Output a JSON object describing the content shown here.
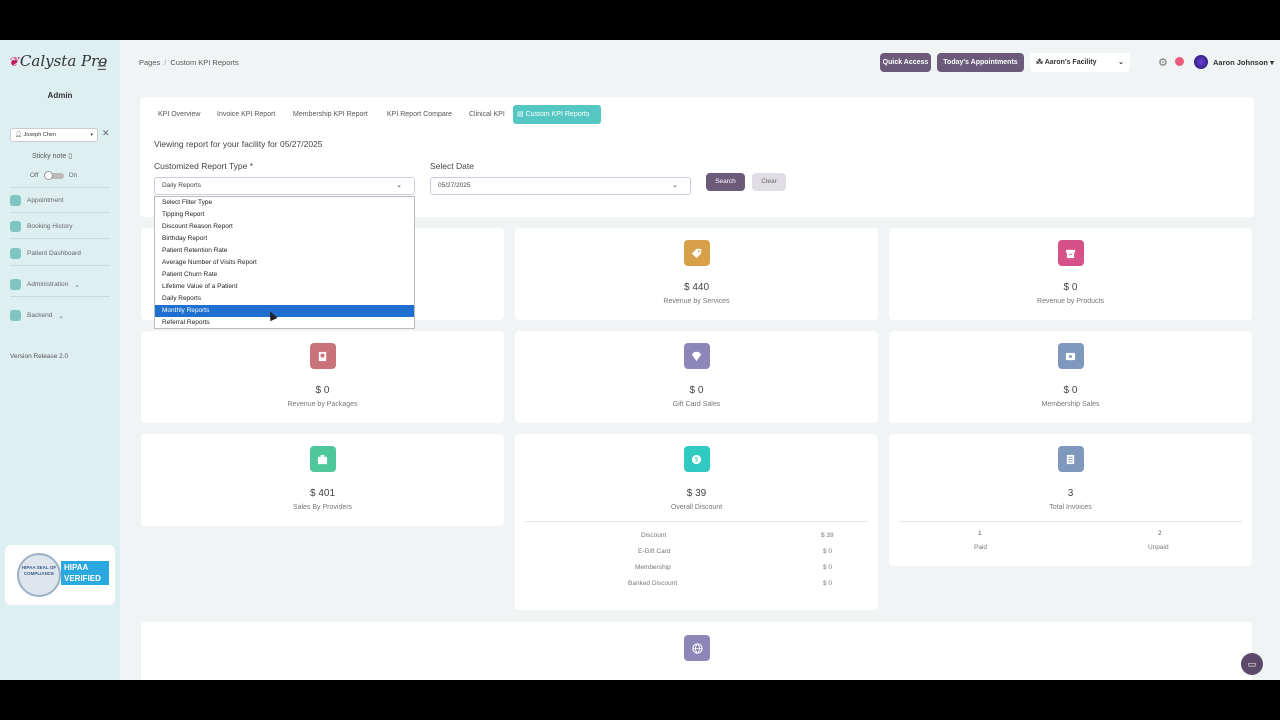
{
  "app": {
    "logo": "Calysta Pro",
    "role_label": "Admin",
    "version": "Version Release 2.0"
  },
  "sidebar": {
    "patient_selected": "Joseph Chen",
    "sticky_note": "Sticky note",
    "toggle_off": "Off",
    "toggle_on": "On",
    "items": [
      {
        "label": "Appointment"
      },
      {
        "label": "Booking History"
      },
      {
        "label": "Patient Dashboard"
      },
      {
        "label": "Administration"
      },
      {
        "label": "Backend"
      }
    ]
  },
  "header": {
    "breadcrumb": [
      "Pages",
      "Custom KPI Reports"
    ],
    "quick_access": "Quick Access",
    "todays_appointments": "Today's Appointments",
    "facility": "Aaron's Facility",
    "user_name": "Aaron Johnson"
  },
  "tabs": [
    {
      "label": "KPI Overview",
      "active": false
    },
    {
      "label": "Invoice KPI Report",
      "active": false
    },
    {
      "label": "Membership KPI Report",
      "active": false
    },
    {
      "label": "KPI Report Compare",
      "active": false
    },
    {
      "label": "Clinical KPI",
      "active": false
    },
    {
      "label": "Custom KPI Reports",
      "active": true
    }
  ],
  "filters": {
    "viewing_text": "Viewing report for your facility for 05/27/2025",
    "report_type_label": "Customized Report Type *",
    "report_type_value": "Daily Reports",
    "date_label": "Select Date",
    "date_value": "05/27/2025",
    "search": "Search",
    "clear": "Clear"
  },
  "dropdown": {
    "options": [
      "Select Filter Type",
      "Tipping Report",
      "Discount Reason Report",
      "Birthday Report",
      "Patient Retention Rate",
      "Average Number of Visits Report",
      "Patient Churn Rate",
      "Lifetime Value of a Patient",
      "Daily Reports",
      "Monthly Reports",
      "Referral Reports"
    ],
    "highlighted": "Monthly Reports"
  },
  "cards": {
    "services": {
      "value": "$ 440",
      "label": "Revenue by Services",
      "color": "#d9a04a"
    },
    "products": {
      "value": "$ 0",
      "label": "Revenue by Products",
      "color": "#d6508a"
    },
    "packages": {
      "value": "$ 0",
      "label": "Revenue by Packages",
      "color": "#c9727a"
    },
    "gift_cards": {
      "value": "$ 0",
      "label": "Gift Card Sales",
      "color": "#8c87b8"
    },
    "membership": {
      "value": "$ 0",
      "label": "Membership Sales",
      "color": "#7f98bd"
    },
    "providers": {
      "value": "$ 401",
      "label": "Sales By Providers",
      "color": "#4ec79a"
    },
    "discount": {
      "value": "$ 39",
      "label": "Overall Discount",
      "color": "#2fcbc2",
      "rows": [
        {
          "name": "Discount",
          "amount": "$ 39"
        },
        {
          "name": "E-Gift Card",
          "amount": "$ 0"
        },
        {
          "name": "Membership",
          "amount": "$ 0"
        },
        {
          "name": "Banked Discount",
          "amount": "$ 0"
        }
      ]
    },
    "invoices": {
      "value": "3",
      "label": "Total Invoices",
      "color": "#7f98bd",
      "paid_count": "1",
      "paid_label": "Paid",
      "unpaid_count": "2",
      "unpaid_label": "Unpaid"
    },
    "bottom": {
      "color": "#8c87b8"
    }
  },
  "hipaa": {
    "seal_text": "HIPAA SEAL OF COMPLIANCE",
    "verified_text": "HIPAA VERIFIED"
  }
}
